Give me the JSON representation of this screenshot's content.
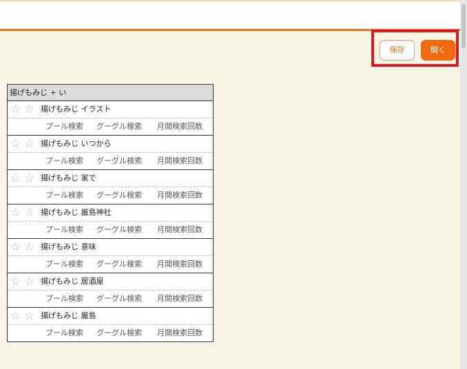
{
  "toolbar": {
    "save_label": "保存",
    "open_label": "開く"
  },
  "keywords": {
    "header": "揚げもみじ + い",
    "items": [
      {
        "text": "揚げもみじ イラスト"
      },
      {
        "text": "揚げもみじ いつから"
      },
      {
        "text": "揚げもみじ 家で"
      },
      {
        "text": "揚げもみじ 厳島神社"
      },
      {
        "text": "揚げもみじ 意味"
      },
      {
        "text": "揚げもみじ 居酒屋"
      },
      {
        "text": "揚げもみじ 厳島"
      }
    ],
    "link_labels": {
      "pool": "プール検索",
      "google": "グーグル検索",
      "monthly": "月間検索回数"
    },
    "star_glyph": "☆"
  },
  "colors": {
    "accent": "#f06a10",
    "highlight_border": "#e0181f",
    "background": "#f8f5e6"
  }
}
